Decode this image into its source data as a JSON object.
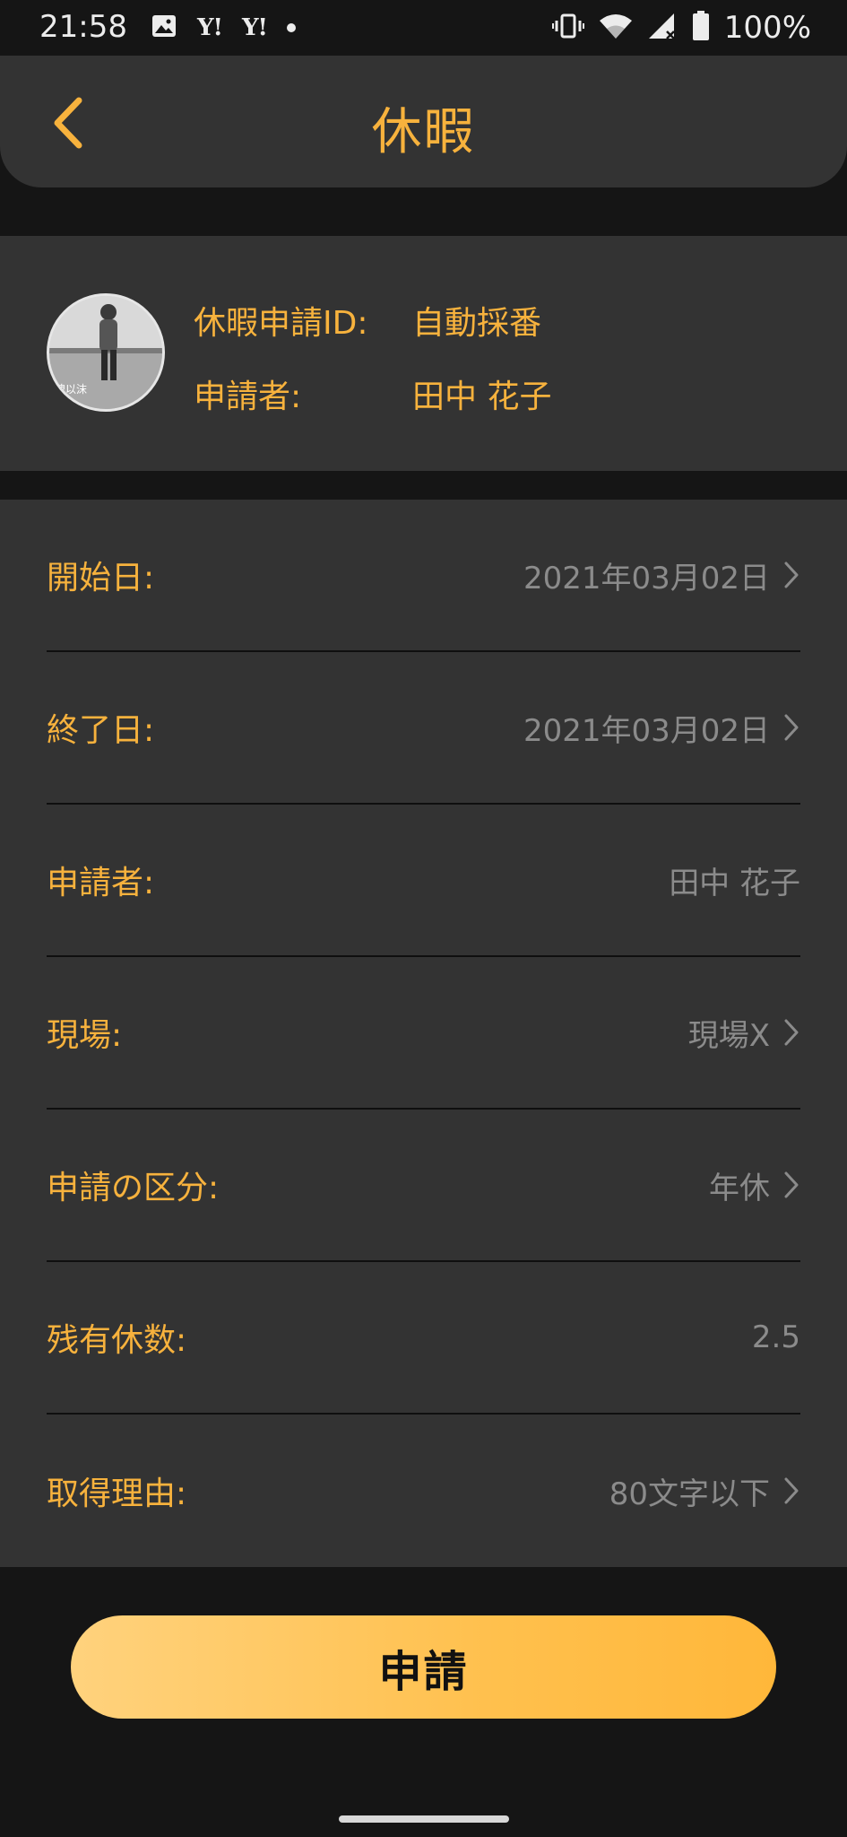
{
  "status_bar": {
    "time": "21:58",
    "left_icons": [
      "image-icon",
      "yahoo-icon",
      "yahoo-icon",
      "dot-icon"
    ],
    "yahoo_label": "Y!",
    "right_icons": [
      "vibrate-icon",
      "wifi-icon",
      "signal-icon",
      "battery-icon"
    ],
    "battery_percent": "100%"
  },
  "header": {
    "title": "休暇",
    "back_icon": "chevron-left-icon"
  },
  "profile": {
    "avatar_caption": "瑰以沫",
    "id_label": "休暇申請ID:",
    "id_value": "自動採番",
    "applicant_label": "申請者:",
    "applicant_value": "田中 花子"
  },
  "form": {
    "rows": [
      {
        "label": "開始日:",
        "value": "2021年03月02日",
        "has_chevron": true
      },
      {
        "label": "終了日:",
        "value": "2021年03月02日",
        "has_chevron": true
      },
      {
        "label": "申請者:",
        "value": "田中 花子",
        "has_chevron": false
      },
      {
        "label": "現場:",
        "value": "現場X",
        "has_chevron": true
      },
      {
        "label": "申請の区分:",
        "value": "年休",
        "has_chevron": true
      },
      {
        "label": "残有休数:",
        "value": "2.5",
        "has_chevron": false
      },
      {
        "label": "取得理由:",
        "value": "80文字以下",
        "has_chevron": true
      }
    ]
  },
  "submit": {
    "label": "申請"
  },
  "colors": {
    "accent": "#f7b23d",
    "card": "#333333",
    "background": "#151515",
    "value_text": "#8b8b8b",
    "button_gradient_start": "#ffd27d",
    "button_gradient_end": "#ffb73a"
  }
}
